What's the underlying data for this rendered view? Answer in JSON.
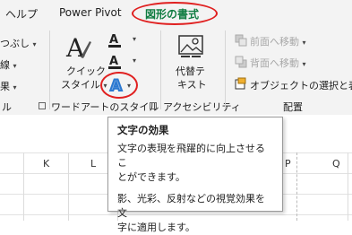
{
  "tabs": {
    "help": "ヘルプ",
    "power_pivot": "Power Pivot",
    "shape_format": "図形の書式"
  },
  "ribbon": {
    "left_partial": {
      "item1": "つぶし",
      "item2": "線",
      "item3": "果"
    },
    "wordart": {
      "quick_style_line1": "クイック",
      "quick_style_line2": "スタイル",
      "group_label": "ワードアートのスタイル"
    },
    "accessibility": {
      "alt_text_line1": "代替テ",
      "alt_text_line2": "キスト",
      "group_label": "アクセシビリティ"
    },
    "arrange": {
      "bring_forward": "前面へ移動",
      "send_backward": "背面へ移動",
      "selection_pane": "オブジェクトの選択と表示",
      "group_label": "配置"
    },
    "left_group_label_partial": "ル"
  },
  "tooltip": {
    "title": "文字の効果",
    "para1_line1": "文字の表現を飛躍的に向上させるこ",
    "para1_line2": "とができます。",
    "para2_line1": "影、光彩、反射などの視覚効果を文",
    "para2_line2": "字に適用します。"
  },
  "columns": [
    "K",
    "L",
    "P",
    "Q"
  ],
  "colors": {
    "active_tab": "#107c41",
    "highlight_ring": "#e02020",
    "text_effect_blue": "#2b78d0"
  }
}
